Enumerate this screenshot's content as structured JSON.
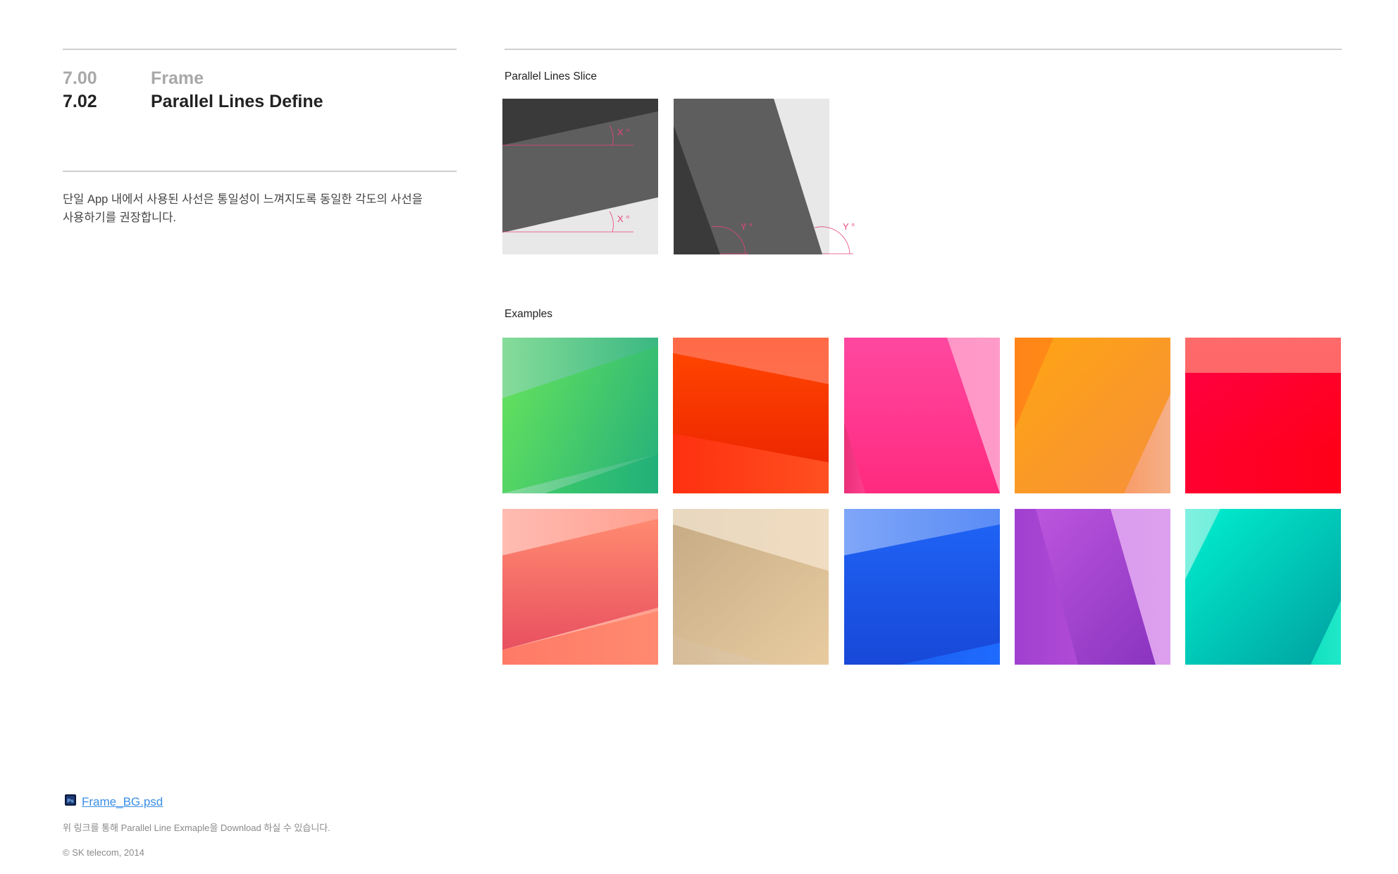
{
  "header": {
    "parent_number": "7.00",
    "parent_title": "Frame",
    "section_number": "7.02",
    "section_title": "Parallel Lines Define"
  },
  "description": {
    "line1": "단일 App 내에서 사용된 사선은 통일성이 느껴지도록 동일한 각도의 사선을",
    "line2": "사용하기를 권장합니다."
  },
  "slice": {
    "label": "Parallel Lines Slice",
    "angle_x_label": "X °",
    "angle_y_label": "Y °"
  },
  "examples": {
    "label": "Examples",
    "tiles": [
      {
        "name": "green",
        "colors": [
          "#5fdf5f",
          "#22b07a",
          "#8fe2a8"
        ]
      },
      {
        "name": "orange-red",
        "colors": [
          "#ff4a00",
          "#ff3a1a",
          "#ff7a55"
        ]
      },
      {
        "name": "pink",
        "colors": [
          "#ff3f8f",
          "#ff2a7f",
          "#ff9bc8"
        ]
      },
      {
        "name": "orange",
        "colors": [
          "#ff9a10",
          "#ff7a20",
          "#f6b08a"
        ]
      },
      {
        "name": "red",
        "colors": [
          "#ff002a",
          "#ff0022",
          "#ff6a6a"
        ]
      },
      {
        "name": "salmon",
        "colors": [
          "#f86a6a",
          "#ff8a70",
          "#ffb8aa"
        ]
      },
      {
        "name": "beige",
        "colors": [
          "#d9bf98",
          "#e0c8a8",
          "#f0dcc0"
        ]
      },
      {
        "name": "blue",
        "colors": [
          "#1a5ff0",
          "#1f6bff",
          "#7fa6f8"
        ]
      },
      {
        "name": "purple",
        "colors": [
          "#b04ad6",
          "#a040d0",
          "#dca0ee"
        ]
      },
      {
        "name": "teal",
        "colors": [
          "#00d8c0",
          "#10e0c0",
          "#80f0e0"
        ]
      }
    ]
  },
  "footer": {
    "psd_link": "Frame_BG.psd",
    "note": "위 링크를 통해 Parallel Line Exmaple을 Download  하실 수 있습니다.",
    "copyright": "© SK telecom, 2014"
  }
}
